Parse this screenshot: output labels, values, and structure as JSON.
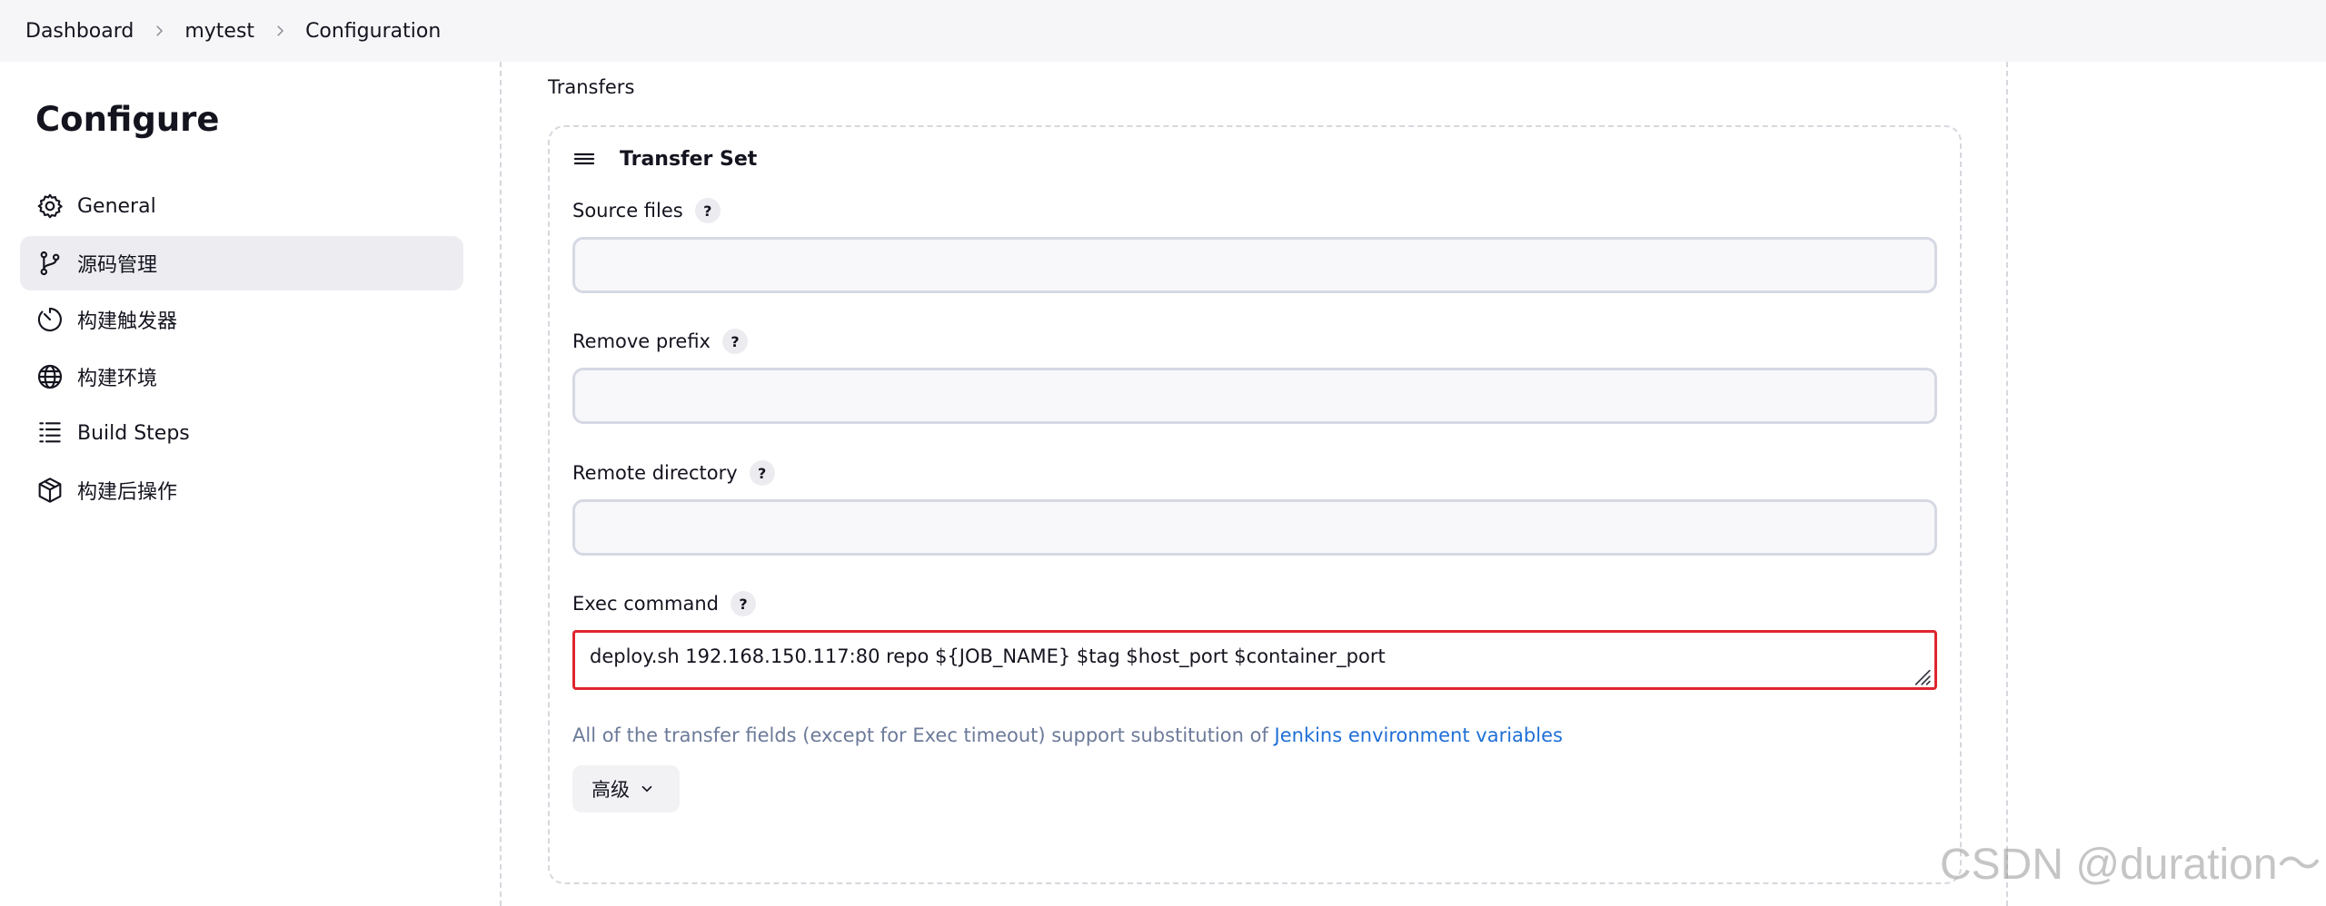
{
  "breadcrumb": [
    "Dashboard",
    "mytest",
    "Configuration"
  ],
  "sidebar": {
    "title": "Configure",
    "items": [
      {
        "label": "General",
        "icon": "gear-icon"
      },
      {
        "label": "源码管理",
        "icon": "source-branch-icon",
        "active": true
      },
      {
        "label": "构建触发器",
        "icon": "timer-icon"
      },
      {
        "label": "构建环境",
        "icon": "globe-icon"
      },
      {
        "label": "Build Steps",
        "icon": "list-icon"
      },
      {
        "label": "构建后操作",
        "icon": "package-icon"
      }
    ]
  },
  "main": {
    "section_label": "Transfers",
    "transfer_set": {
      "title": "Transfer Set",
      "fields": {
        "source_files": {
          "label": "Source files",
          "value": ""
        },
        "remove_prefix": {
          "label": "Remove prefix",
          "value": ""
        },
        "remote_directory": {
          "label": "Remote directory",
          "value": ""
        },
        "exec_command": {
          "label": "Exec command",
          "value": "deploy.sh 192.168.150.117:80 repo ${JOB_NAME} $tag $host_port $container_port"
        }
      },
      "help_label": "?",
      "hint": {
        "text": "All of the transfer fields (except for Exec timeout) support substitution of ",
        "link": "Jenkins environment variables"
      },
      "advanced_label": "高级"
    }
  },
  "watermark": "CSDN @duration～",
  "colors": {
    "error_border": "#e0252f",
    "link": "#1f6fd6",
    "hint": "#6c7a99",
    "active_bg": "#ededf1"
  }
}
